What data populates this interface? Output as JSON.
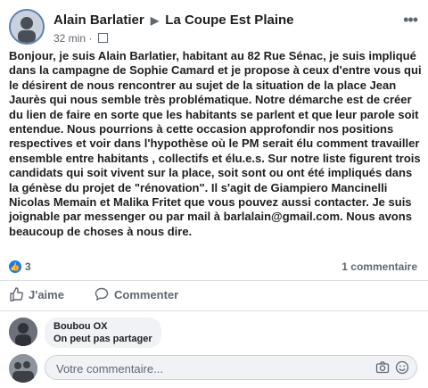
{
  "post": {
    "author": "Alain Barlatier",
    "arrow": "▶",
    "group": "La Coupe Est Plaine",
    "time": "32 min",
    "separator": "·",
    "more": "•••",
    "body_part1": "Bonjour, je suis Alain Barlatier, habitant au 82 Rue Sénac, je suis impliqué dans la campagne de Sophie Camard et je  propose à ceux d'entre vous qui le désirent de nous rencontrer au sujet de la situation de la place Jean Jaurès qui nous semble très problématique. Notre démarche est de créer du lien de faire en sorte que les habitants se parlent et que leur parole soit entendue. Nous pourrions à cette occasion approfondir nos positions respectives et voir dans l'hypothèse où le PM serait élu comment travailler ensemble entre habitants , collectifs et élu.e.s. Sur notre liste figurent trois candidats qui soit vivent sur la place, soit sont ou ont été impliqués dans la génèse du projet de \"rénovation\". Il s'agit de ",
    "body_bold": "Giampiero Mancinelli",
    "body_part2": " Nicolas Memain et Malika Fritet que vous pouvez aussi contacter. Je suis joignable par messenger ou par mail à barlalain@gmail.com. Nous avons beaucoup de choses à nous dire.",
    "reaction_count": "3",
    "comment_count": "1 commentaire"
  },
  "actions": {
    "like_label": "J'aime",
    "comment_label": "Commenter"
  },
  "comments": [
    {
      "name": "Boubou OX",
      "text": "On peut pas partager"
    }
  ],
  "composer": {
    "placeholder": "Votre commentaire..."
  },
  "colors": {
    "accent": "#1877f2",
    "secondary_text": "#606770",
    "bubble": "#f0f2f5"
  },
  "icons": [
    "more-options-icon",
    "group-icon",
    "like-reaction-icon",
    "thumbs-up-icon",
    "comment-icon",
    "camera-icon",
    "emoji-icon"
  ]
}
